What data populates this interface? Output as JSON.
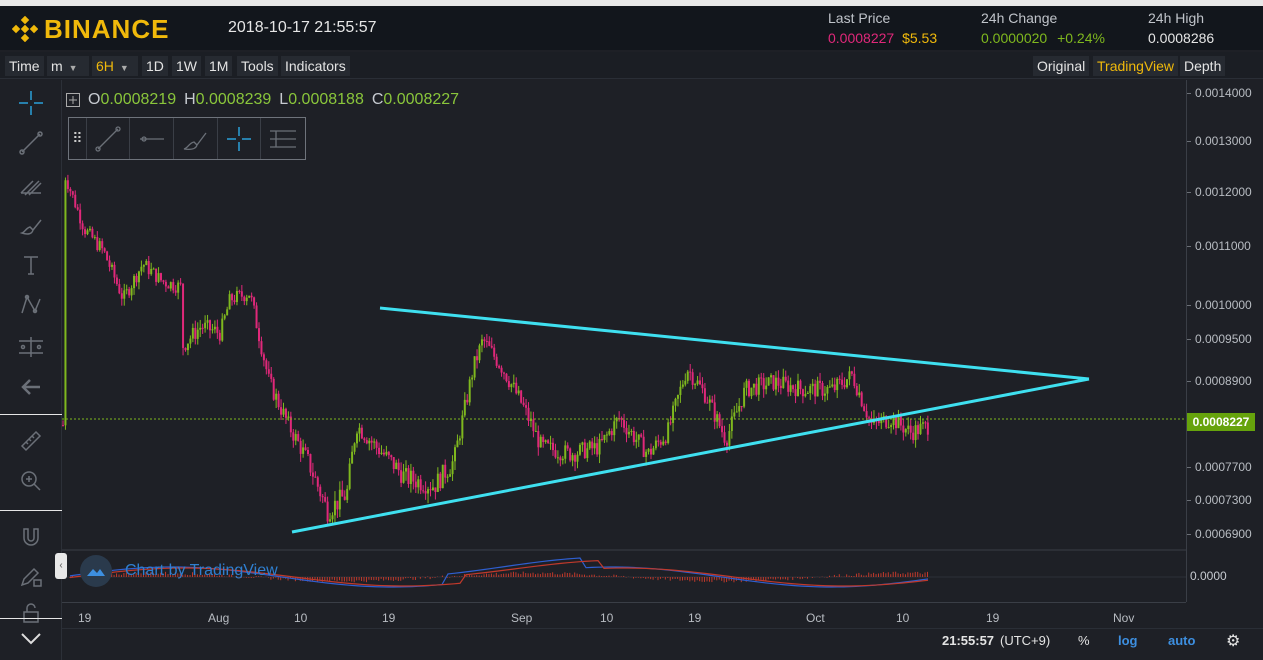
{
  "header": {
    "brand": "BINANCE",
    "datetime": "2018-10-17 21:55:57",
    "last_price_label": "Last Price",
    "last_price": "0.0008227",
    "last_price_usd": "$5.53",
    "change_label": "24h Change",
    "change_value": "0.0000020",
    "change_pct": "+0.24%",
    "high_label": "24h High",
    "high_value": "0.0008286"
  },
  "toolbar": {
    "time": "Time",
    "minute": "m",
    "interval": "6H",
    "d1": "1D",
    "w1": "1W",
    "m1": "1M",
    "tools": "Tools",
    "indicators": "Indicators",
    "original": "Original",
    "tradingview": "TradingView",
    "depth": "Depth"
  },
  "legend": {
    "o_label": "O",
    "o_value": "0.0008219",
    "h_label": "H",
    "h_value": "0.0008239",
    "l_label": "L",
    "l_value": "0.0008188",
    "c_label": "C",
    "c_value": "0.0008227"
  },
  "price_ticks": [
    "0.0014000",
    "0.0013000",
    "0.0012000",
    "0.0011000",
    "0.0010000",
    "0.0009500",
    "0.0008900",
    "0.0007700",
    "0.0007300",
    "0.0006900"
  ],
  "current_price_tag": "0.0008227",
  "macd_value": "0.0000",
  "time_ticks": [
    "19",
    "Aug",
    "10",
    "19",
    "Sep",
    "10",
    "19",
    "Oct",
    "10",
    "19",
    "Nov"
  ],
  "branding": "Chart by TradingView",
  "footer": {
    "clock": "21:55:57",
    "tz": "(UTC+9)",
    "pct": "%",
    "log": "log",
    "auto": "auto"
  },
  "colors": {
    "brand": "#f0b90b",
    "up": "#7fb81e",
    "down": "#e0287a",
    "trendline": "#3fe0f0",
    "accent_blue": "#2f7fd0"
  },
  "chart_data": {
    "type": "candlestick",
    "interval": "6H",
    "close_path": [
      [
        "Jul 19",
        0.00122
      ],
      [
        "Jul 21",
        0.00112
      ],
      [
        "Jul 23",
        0.00108
      ],
      [
        "Jul 25",
        0.001
      ],
      [
        "Jul 27",
        0.00106
      ],
      [
        "Jul 29",
        0.00103
      ],
      [
        "Jul 31",
        0.00102
      ],
      [
        "Aug 1",
        0.00093
      ],
      [
        "Aug 3",
        0.00096
      ],
      [
        "Aug 5",
        0.00095
      ],
      [
        "Aug 6",
        0.001
      ],
      [
        "Aug 8",
        0.00101
      ],
      [
        "Aug 10",
        0.00088
      ],
      [
        "Aug 12",
        0.00082
      ],
      [
        "Aug 14",
        0.00077
      ],
      [
        "Aug 16",
        0.00071
      ],
      [
        "Aug 18",
        0.00073
      ],
      [
        "Aug 19",
        0.00082
      ],
      [
        "Aug 21",
        0.00079
      ],
      [
        "Aug 24",
        0.00075
      ],
      [
        "Aug 27",
        0.00074
      ],
      [
        "Aug 29",
        0.00077
      ],
      [
        "Aug 31",
        0.0009
      ],
      [
        "Sep 1",
        0.00094
      ],
      [
        "Sep 3",
        0.0009
      ],
      [
        "Sep 5",
        0.00085
      ],
      [
        "Sep 7",
        0.00079
      ],
      [
        "Sep 10",
        0.00078
      ],
      [
        "Sep 13",
        0.00079
      ],
      [
        "Sep 15",
        0.00083
      ],
      [
        "Sep 18",
        0.00078
      ],
      [
        "Sep 20",
        0.00081
      ],
      [
        "Sep 22",
        0.0009
      ],
      [
        "Sep 24",
        0.00086
      ],
      [
        "Sep 26",
        0.0008
      ],
      [
        "Sep 28",
        0.00087
      ],
      [
        "Oct 1",
        0.00088
      ],
      [
        "Oct 4",
        0.00087
      ],
      [
        "Oct 7",
        0.00087
      ],
      [
        "Oct 9",
        0.00089
      ],
      [
        "Oct 11",
        0.00082
      ],
      [
        "Oct 13",
        0.00083
      ],
      [
        "Oct 15",
        0.00081
      ],
      [
        "Oct 17",
        0.00082
      ]
    ]
  }
}
